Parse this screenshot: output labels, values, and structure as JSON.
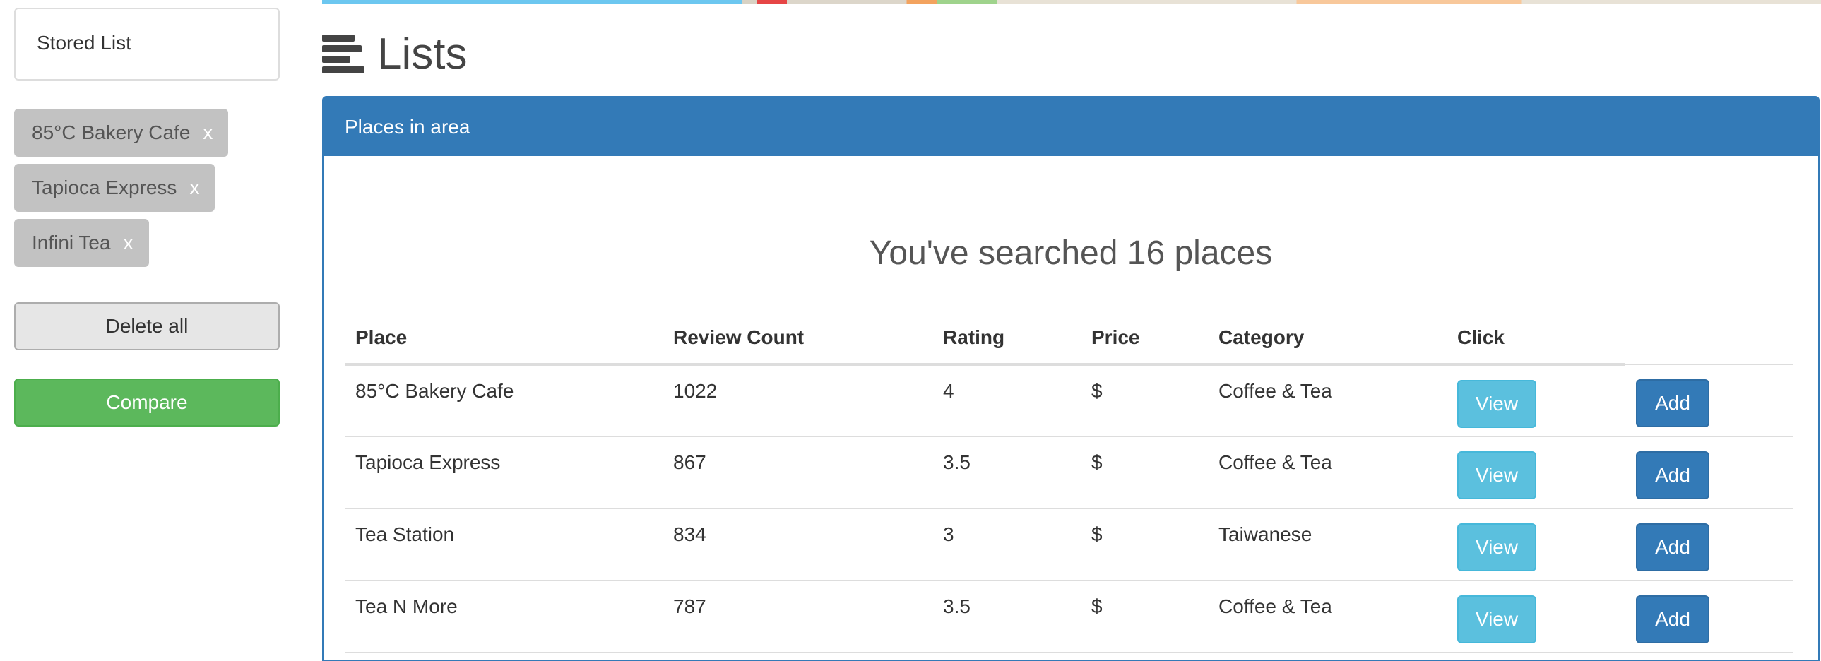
{
  "sidebar": {
    "stored_list_title": "Stored List",
    "chips": [
      {
        "label": "85°C Bakery Cafe",
        "remove": "x"
      },
      {
        "label": "Tapioca Express",
        "remove": "x"
      },
      {
        "label": "Infini Tea",
        "remove": "x"
      }
    ],
    "delete_all_label": "Delete all",
    "compare_label": "Compare"
  },
  "heading": {
    "icon": "bars-icon",
    "title": "Lists"
  },
  "panel": {
    "heading": "Places in area",
    "subtitle": "You've searched 16 places",
    "columns": [
      "Place",
      "Review Count",
      "Rating",
      "Price",
      "Category",
      "Click"
    ],
    "rows": [
      {
        "place": "85°C Bakery Cafe",
        "review_count": "1022",
        "rating": "4",
        "price": "$",
        "category": "Coffee & Tea",
        "view": "View",
        "add": "Add"
      },
      {
        "place": "Tapioca Express",
        "review_count": "867",
        "rating": "3.5",
        "price": "$",
        "category": "Coffee & Tea",
        "view": "View",
        "add": "Add"
      },
      {
        "place": "Tea Station",
        "review_count": "834",
        "rating": "3",
        "price": "$",
        "category": "Taiwanese",
        "view": "View",
        "add": "Add"
      },
      {
        "place": "Tea N More",
        "review_count": "787",
        "rating": "3.5",
        "price": "$",
        "category": "Coffee & Tea",
        "view": "View",
        "add": "Add"
      }
    ]
  },
  "colors": {
    "primary": "#337ab7",
    "info": "#5bc0de",
    "success": "#5cb85c",
    "chip": "#c2c2c2"
  }
}
